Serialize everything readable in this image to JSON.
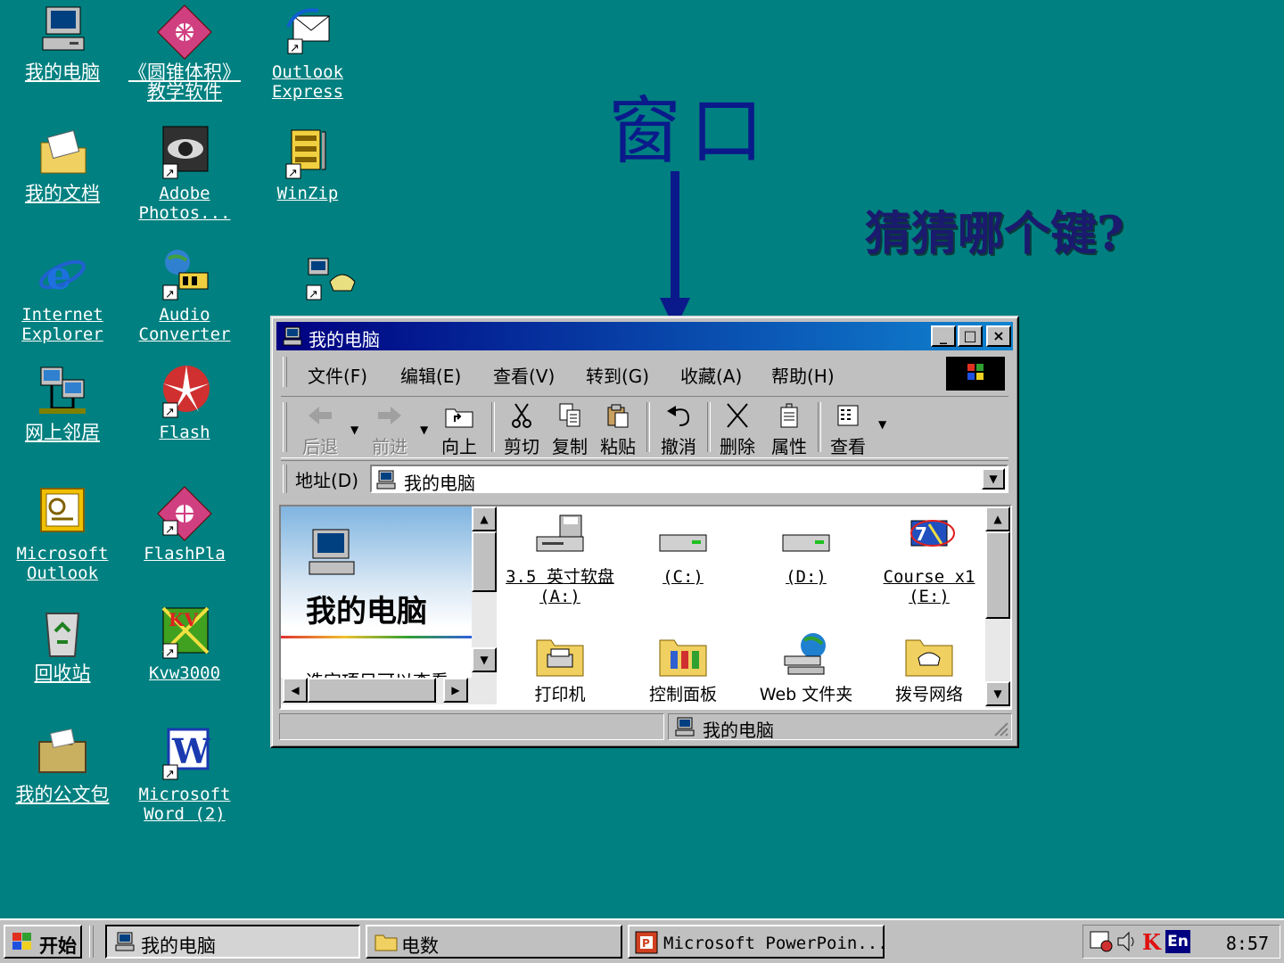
{
  "desktop": {
    "background_color": "#008080",
    "icons": [
      {
        "label": "我的电脑",
        "icon": "my-computer-icon"
      },
      {
        "label": "《圆锥体积》\n教学软件",
        "icon": "software-icon"
      },
      {
        "label": "Outlook\nExpress",
        "icon": "outlook-express-icon"
      },
      {
        "label": "我的文档",
        "icon": "my-documents-icon"
      },
      {
        "label": "Adobe\nPhotos...",
        "icon": "photoshop-icon"
      },
      {
        "label": "WinZip",
        "icon": "winzip-icon"
      },
      {
        "label": "Internet\nExplorer",
        "icon": "internet-explorer-icon"
      },
      {
        "label": "Audio\nConverter",
        "icon": "audio-converter-icon"
      },
      {
        "label": "",
        "icon": "dialup-icon"
      },
      {
        "label": "网上邻居",
        "icon": "network-icon"
      },
      {
        "label": "Flash",
        "icon": "flash-icon"
      },
      {
        "label": "Microsoft\nOutlook",
        "icon": "ms-outlook-icon"
      },
      {
        "label": "FlashPla",
        "icon": "flashplayer-icon"
      },
      {
        "label": "回收站",
        "icon": "recycle-bin-icon"
      },
      {
        "label": "Kvw3000",
        "icon": "kvw-icon"
      },
      {
        "label": "我的公文包",
        "icon": "briefcase-icon"
      },
      {
        "label": "Microsoft\nWord (2)",
        "icon": "word-icon"
      }
    ]
  },
  "annotation": {
    "title": "窗口",
    "question": "猜猜哪个键?"
  },
  "window": {
    "title": "我的电脑",
    "controls": {
      "minimize": "_",
      "maximize": "□",
      "close": "×"
    },
    "menu": [
      "文件(F)",
      "编辑(E)",
      "查看(V)",
      "转到(G)",
      "收藏(A)",
      "帮助(H)"
    ],
    "toolbar": {
      "back": "后退",
      "forward": "前进",
      "up": "向上",
      "cut": "剪切",
      "copy": "复制",
      "paste": "粘贴",
      "undo": "撤消",
      "delete": "删除",
      "properties": "属性",
      "views": "查看"
    },
    "address": {
      "label": "地址(D)",
      "value": "我的电脑"
    },
    "left_pane": {
      "title": "我的电脑",
      "partial_text": "选定项目可以查看"
    },
    "items": [
      {
        "label": "3.5 英寸软盘\n(A:)",
        "icon": "floppy-icon"
      },
      {
        "label": "(C:)",
        "icon": "hard-drive-icon"
      },
      {
        "label": "(D:)",
        "icon": "hard-drive-icon"
      },
      {
        "label": "Course x1\n(E:)",
        "icon": "cd-drive-icon"
      },
      {
        "label": "打印机",
        "icon": "printers-folder-icon"
      },
      {
        "label": "控制面板",
        "icon": "control-panel-icon"
      },
      {
        "label": "Web 文件夹",
        "icon": "web-folders-icon"
      },
      {
        "label": "拨号网络",
        "icon": "dialup-networking-icon"
      }
    ],
    "status": "我的电脑"
  },
  "taskbar": {
    "start": "开始",
    "tasks": [
      "我的电脑",
      "电数",
      "Microsoft PowerPoin..."
    ],
    "tray": {
      "ime": "En",
      "clock": "8:57"
    }
  }
}
